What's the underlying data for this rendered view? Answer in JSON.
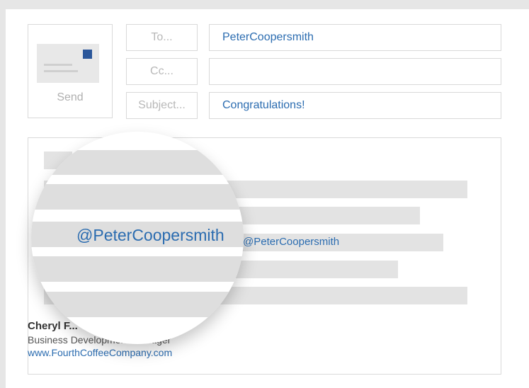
{
  "compose": {
    "send_label": "Send",
    "to_label": "To...",
    "cc_label": "Cc...",
    "subject_label": "Subject...",
    "to_value": "PeterCoopersmith",
    "cc_value": "",
    "subject_value": "Congratulations!"
  },
  "body": {
    "mention_inline": "@PeterCoopersmith",
    "mention_magnified": "@PeterCoopersmith"
  },
  "signature": {
    "name": "Cheryl F...",
    "title": "Business Development Manager",
    "website": "www.FourthCoffeeCompany.com"
  },
  "icons": {
    "send": "envelope-icon"
  },
  "colors": {
    "accent": "#2b6cb0",
    "stamp": "#2b579a",
    "placeholder_bar": "#e3e3e3"
  }
}
